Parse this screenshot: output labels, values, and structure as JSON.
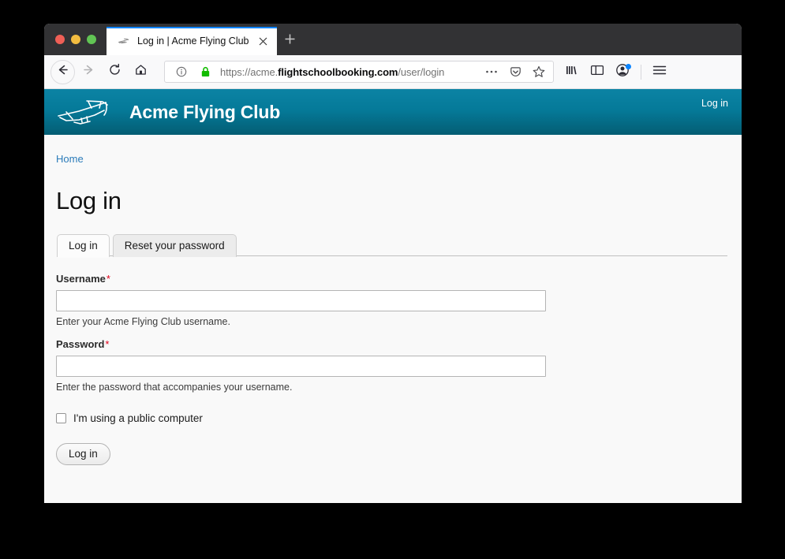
{
  "browser": {
    "tab": {
      "title": "Log in | Acme Flying Club",
      "favicon_icon": "airplane-icon",
      "close_icon": "close-icon"
    },
    "new_tab_icon": "plus-icon",
    "nav": {
      "back_icon": "back-arrow-icon",
      "forward_icon": "forward-arrow-icon",
      "reload_icon": "reload-icon",
      "home_icon": "home-icon"
    },
    "urlbar": {
      "info_icon": "info-circle-icon",
      "lock_icon": "padlock-icon",
      "scheme": "https://acme.",
      "host": "flightschoolbooking.com",
      "path": "/user/login",
      "full_url": "https://acme.flightschoolbooking.com/user/login",
      "more_icon": "ellipsis-icon",
      "pocket_icon": "pocket-icon",
      "bookmark_icon": "star-icon"
    },
    "toolbar_right": {
      "library_icon": "library-icon",
      "sidebar_icon": "sidebar-icon",
      "account_icon": "account-avatar-icon",
      "menu_icon": "hamburger-menu-icon"
    },
    "window_controls": {
      "close_label": "close",
      "minimize_label": "minimize",
      "maximize_label": "maximize"
    }
  },
  "site": {
    "logo_icon": "airplane-logo-icon",
    "name": "Acme Flying Club",
    "header_login_label": "Log in"
  },
  "page": {
    "breadcrumb": "Home",
    "title": "Log in",
    "tabs": [
      {
        "label": "Log in",
        "active": true
      },
      {
        "label": "Reset your password",
        "active": false
      }
    ],
    "form": {
      "username": {
        "label": "Username",
        "required_marker": "*",
        "value": "",
        "placeholder": "",
        "help": "Enter your Acme Flying Club username."
      },
      "password": {
        "label": "Password",
        "required_marker": "*",
        "value": "",
        "placeholder": "",
        "help": "Enter the password that accompanies your username."
      },
      "public_computer": {
        "label": "I'm using a public computer",
        "checked": false
      },
      "submit_label": "Log in"
    }
  },
  "colors": {
    "brand_teal_top": "#0c83a4",
    "brand_teal_bottom": "#045d73",
    "link_blue": "#2b7bb9",
    "required_red": "#e1001a",
    "tab_accent_blue": "#0a84ff"
  }
}
